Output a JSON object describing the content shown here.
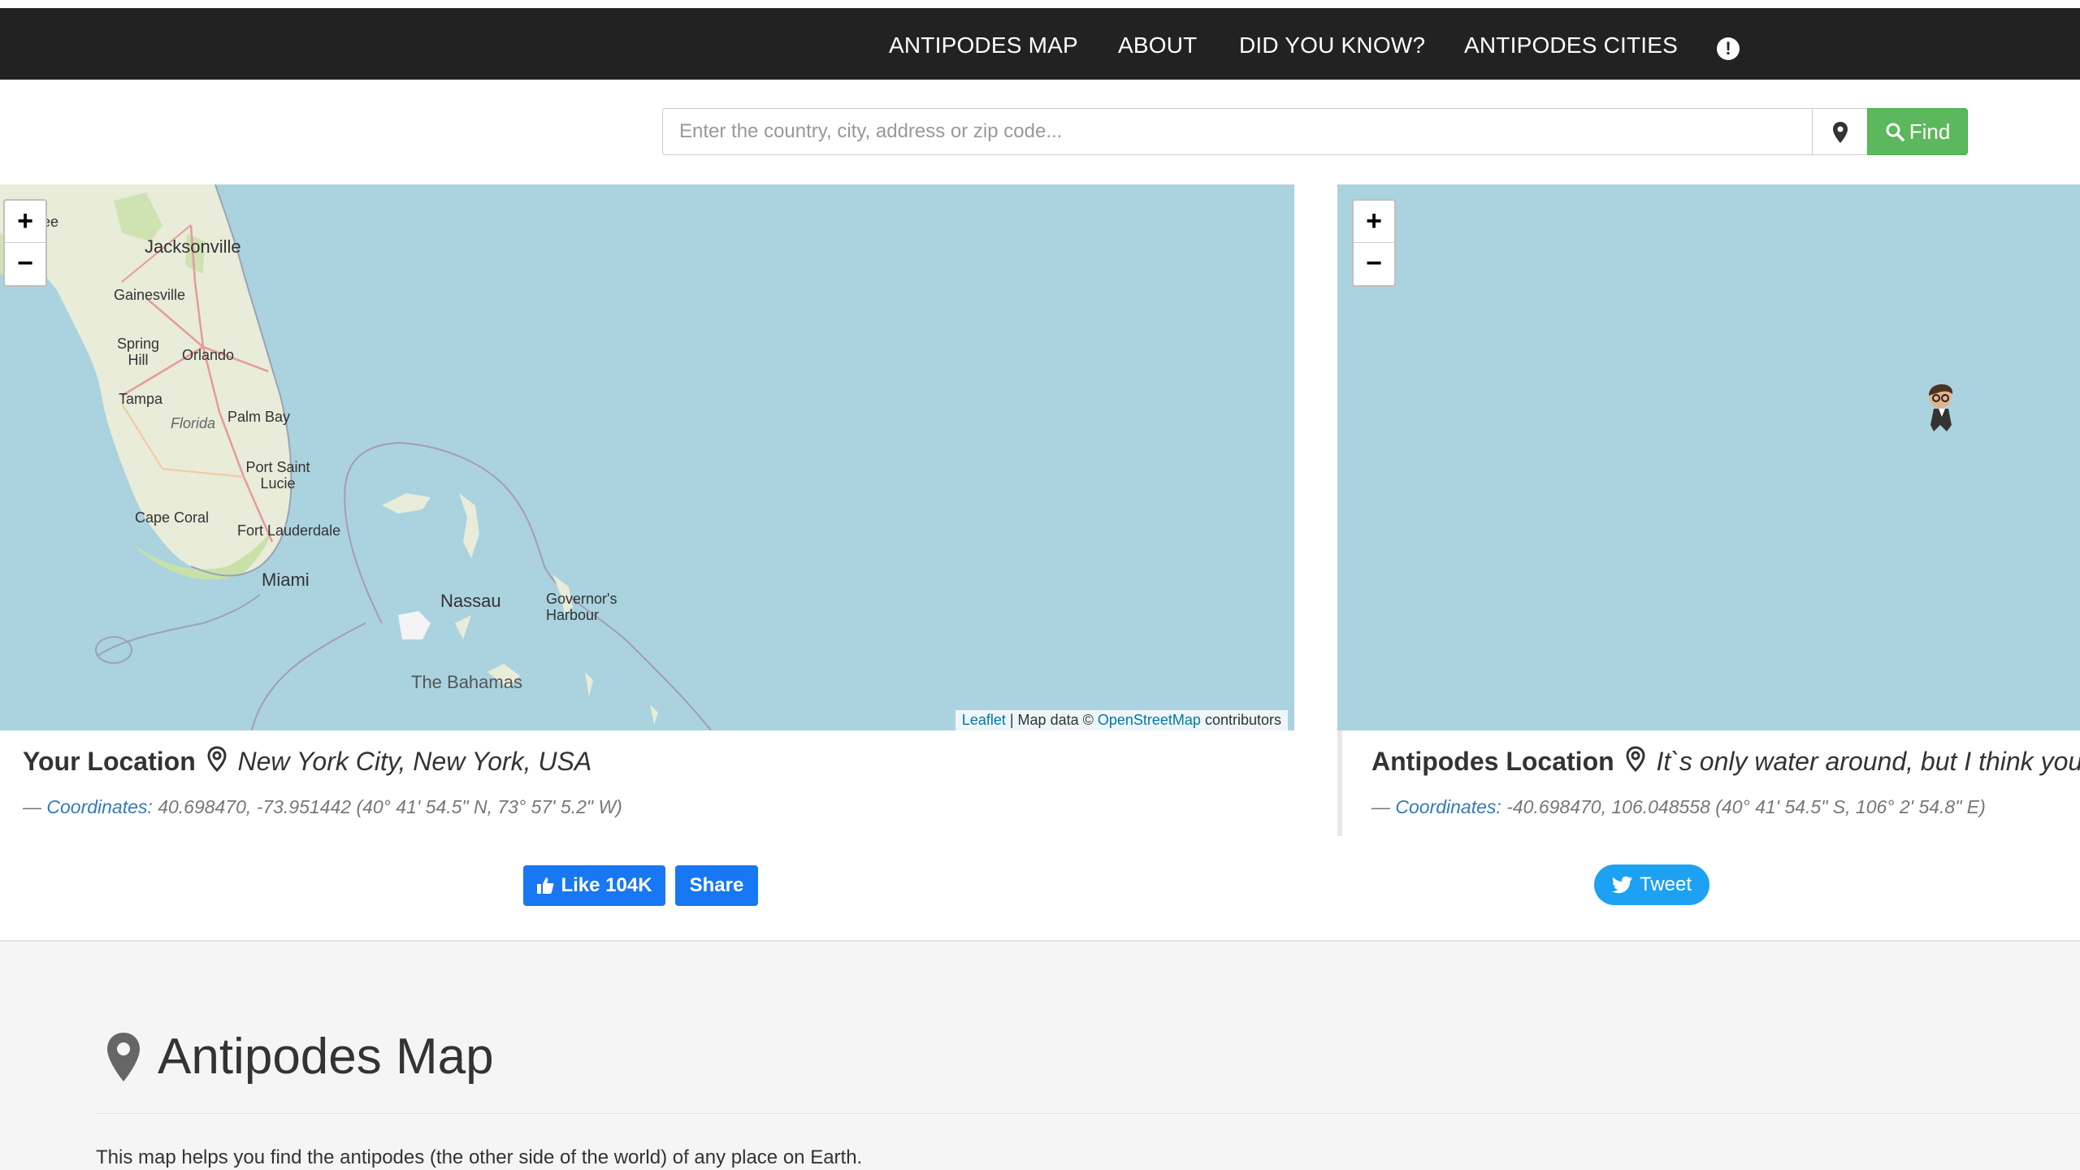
{
  "nav": {
    "items": [
      "ANTIPODES MAP",
      "ABOUT",
      "DID YOU KNOW?",
      "ANTIPODES CITIES"
    ],
    "info_icon": "exclamation-circle-icon"
  },
  "search": {
    "placeholder": "Enter the country, city, address or zip code...",
    "find_label": "Find"
  },
  "map_left": {
    "cities": {
      "jacksonville": "Jacksonville",
      "gainesville": "Gainesville",
      "spring_hill": "Spring Hill",
      "orlando": "Orlando",
      "tampa": "Tampa",
      "florida": "Florida",
      "palm_bay": "Palm Bay",
      "port_saint_lucie": "Port Saint Lucie",
      "cape_coral": "Cape Coral",
      "fort_lauderdale": "Fort Lauderdale",
      "miami": "Miami",
      "nassau": "Nassau",
      "governors_harbour": "Governor's Harbour",
      "the_bahamas": "The Bahamas",
      "ee": "ee"
    },
    "attribution": {
      "leaflet": "Leaflet",
      "mid": " | Map data © ",
      "osm": "OpenStreetMap",
      "end": " contributors"
    }
  },
  "your_location": {
    "label": "Your Location",
    "place": "New York City, New York, USA",
    "dash": "— ",
    "coords_label": "Coordinates:",
    "coords_value": " 40.698470, -73.951442 (40° 41' 54.5\" N, 73° 57' 5.2\" W)"
  },
  "antipodes_location": {
    "label": "Antipodes Location",
    "place": "It`s only water around, but I think you ca",
    "dash": "— ",
    "coords_label": "Coordinates:",
    "coords_value": " -40.698470, 106.048558 (40° 41' 54.5\" S, 106° 2' 54.8\" E)"
  },
  "social": {
    "like_label": "Like 104K",
    "share_label": "Share",
    "tweet_label": "Tweet"
  },
  "section": {
    "title": "Antipodes Map",
    "text": "This map helps you find the antipodes (the other side of the world) of any place on Earth."
  },
  "colors": {
    "navbar": "#222222",
    "water": "#aad3df",
    "find_button": "#5cb85c",
    "facebook": "#1877f2",
    "twitter": "#1da1f2",
    "link": "#337ab7"
  }
}
